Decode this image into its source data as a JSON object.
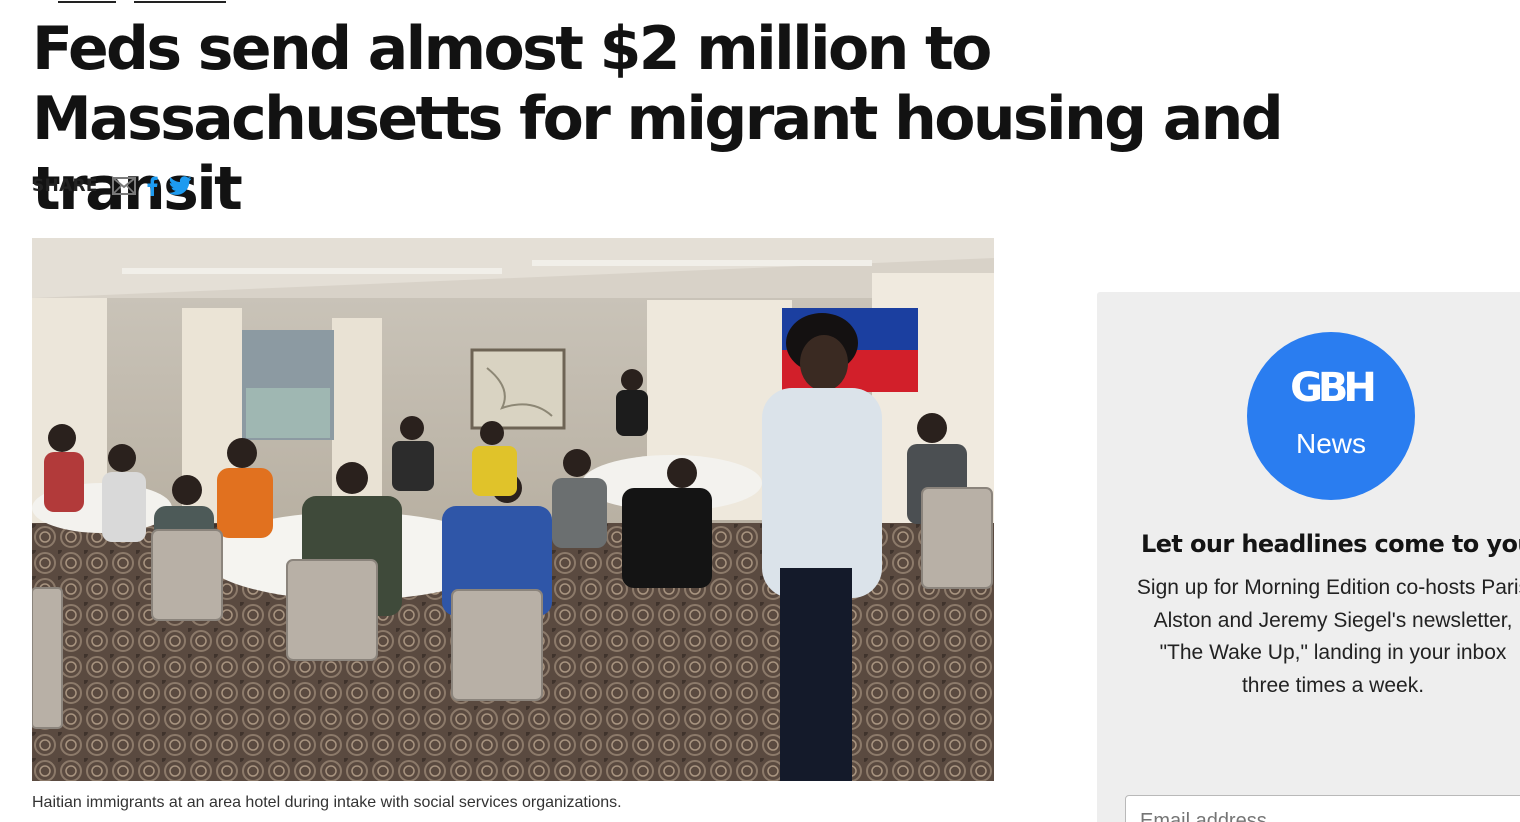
{
  "article": {
    "headline": "Feds send almost $2 million to Massachusetts for migrant housing and transit",
    "share_label": "SHARE",
    "share_icons": [
      "email-icon",
      "facebook-icon",
      "twitter-icon"
    ],
    "image_caption": "Haitian immigrants at an area hotel during intake with social services organizations."
  },
  "sidebar": {
    "logo_mark": "GBH",
    "logo_sub": "News",
    "promo_title": "Let our headlines come to you.",
    "promo_text": "Sign up for Morning Edition co-hosts Paris Alston and Jeremy Siegel's newsletter, \"The Wake Up,\" landing in your inbox three times a week.",
    "email_placeholder": "Email address"
  },
  "colors": {
    "brand_blue": "#2a7df0",
    "twitter_blue": "#1d9bf0",
    "sidebar_bg": "#eeeeee"
  }
}
